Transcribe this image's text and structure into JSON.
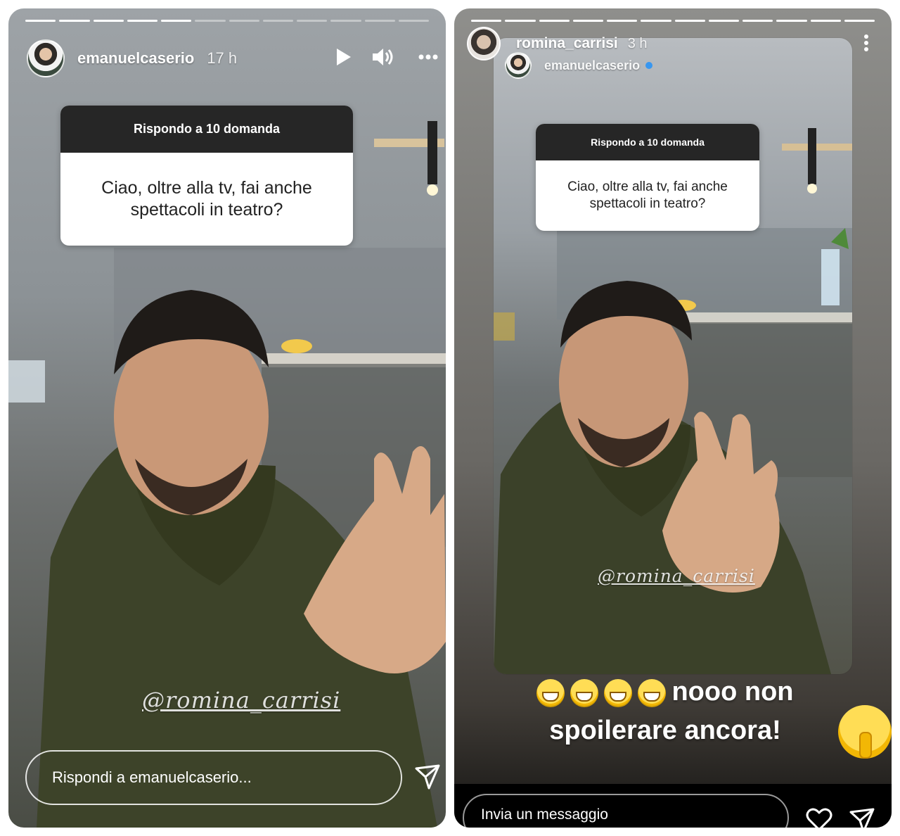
{
  "left_story": {
    "username": "emanuelcaserio",
    "time": "17 h",
    "question_header": "Rispondo a 10 domanda",
    "question_text": "Ciao, oltre alla tv, fai anche\nspettacoli in teatro?",
    "mention": "@romina_carrisi",
    "reply_placeholder": "Rispondi a emanuelcaserio...",
    "icons": [
      "play-icon",
      "volume-icon",
      "more-icon",
      "send-icon"
    ],
    "progress_total": 12,
    "progress_done": 5
  },
  "right_story": {
    "username": "romina_carrisi",
    "time": "3 h",
    "reshared_username": "emanuelcaserio",
    "question_header": "Rispondo a 10 domanda",
    "question_text": "Ciao, oltre alla tv, fai anche\nspettacoli in teatro?",
    "mention": "@romina_carrisi",
    "caption_line1": "nooo non",
    "caption_line2": "spoilerare ancora!",
    "emoji_count": 4,
    "message_placeholder": "Invia un messaggio",
    "icons": [
      "more-vertical-icon",
      "heart-icon",
      "send-icon",
      "verified-icon"
    ],
    "progress_total": 12,
    "progress_done": 12
  },
  "colors": {
    "question_header_bg": "#262626",
    "verified": "#3897f0",
    "emoji_yellow": "#ffdd55"
  }
}
